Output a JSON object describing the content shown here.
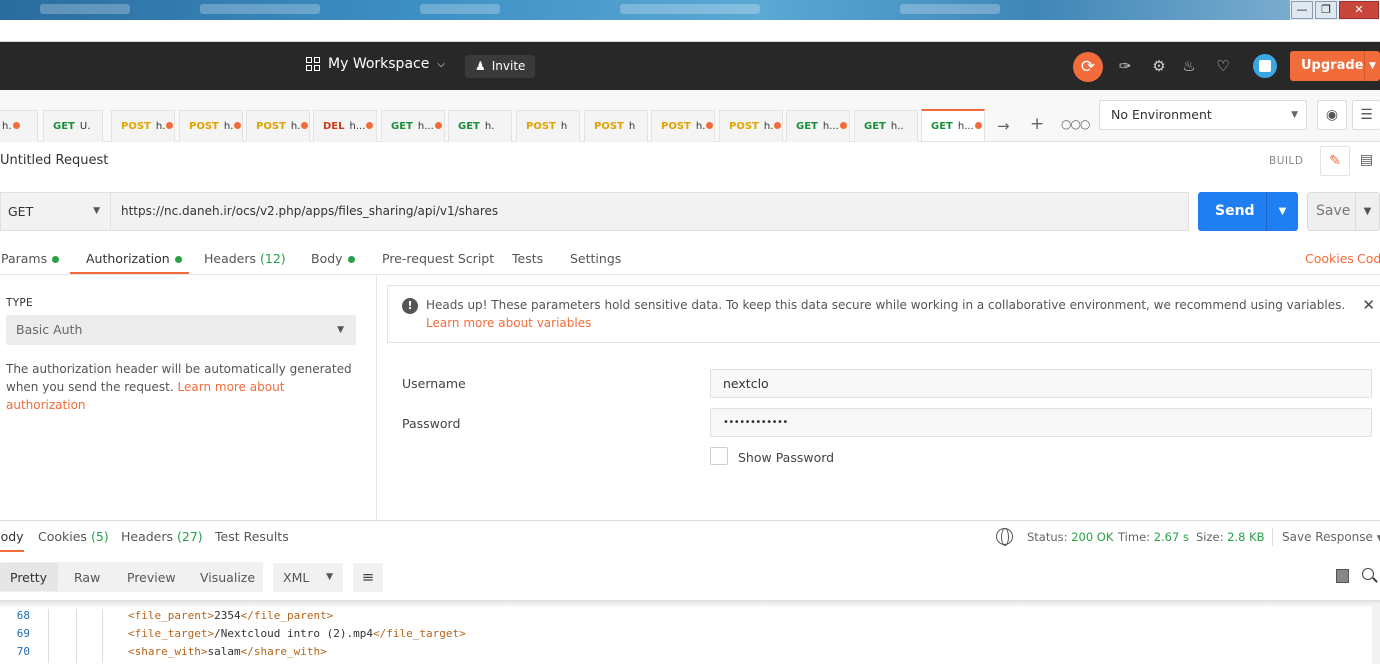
{
  "header": {
    "workspace": "My Workspace",
    "invite": "Invite",
    "upgrade": "Upgrade"
  },
  "tabs": [
    {
      "method": "",
      "label": "h.",
      "dot": true
    },
    {
      "method": "GET",
      "label": "U.",
      "dot": false
    },
    {
      "method": "POST",
      "label": "h.",
      "dot": true
    },
    {
      "method": "POST",
      "label": "h.",
      "dot": true
    },
    {
      "method": "POST",
      "label": "h.",
      "dot": true
    },
    {
      "method": "DEL",
      "label": "h...",
      "dot": true
    },
    {
      "method": "GET",
      "label": "h...",
      "dot": true
    },
    {
      "method": "GET",
      "label": "h.",
      "dot": false
    },
    {
      "method": "POST",
      "label": "h",
      "dot": false
    },
    {
      "method": "POST",
      "label": "h",
      "dot": false
    },
    {
      "method": "POST",
      "label": "h.",
      "dot": true
    },
    {
      "method": "POST",
      "label": "h.",
      "dot": true
    },
    {
      "method": "GET",
      "label": "h...",
      "dot": true
    },
    {
      "method": "GET",
      "label": "h..",
      "dot": false
    },
    {
      "method": "GET",
      "label": "h...",
      "dot": true,
      "active": true
    }
  ],
  "environment": {
    "selected": "No Environment"
  },
  "request": {
    "title": "Untitled Request",
    "build": "BUILD",
    "method": "GET",
    "url": "https://nc.daneh.ir/ocs/v2.php/apps/files_sharing/api/v1/shares",
    "send": "Send",
    "save": "Save"
  },
  "request_tabs": {
    "params": "Params",
    "authorization": "Authorization",
    "headers": "Headers",
    "headers_count": "(12)",
    "body": "Body",
    "prerequest": "Pre-request Script",
    "tests": "Tests",
    "settings": "Settings",
    "cookies": "Cookies",
    "code": "Cod"
  },
  "auth": {
    "type_label": "TYPE",
    "type_value": "Basic Auth",
    "description": "The authorization header will be automatically generated when you send the request.",
    "learn_more": "Learn more about authorization",
    "alert_text": "Heads up! These parameters hold sensitive data. To keep this data secure while working in a collaborative environment, we recommend using variables.",
    "alert_link": "Learn more about variables",
    "username_label": "Username",
    "username_value": "nextclo",
    "password_label": "Password",
    "password_value": "••••••••••••",
    "show_password": "Show Password"
  },
  "response": {
    "tabs": {
      "body": "Body",
      "cookies": "Cookies",
      "cookies_count": "(5)",
      "headers": "Headers",
      "headers_count": "(27)",
      "tests": "Test Results"
    },
    "status_label": "Status:",
    "status_value": "200 OK",
    "time_label": "Time:",
    "time_value": "2.67 s",
    "size_label": "Size:",
    "size_value": "2.8 KB",
    "save_response": "Save Response",
    "formats": {
      "pretty": "Pretty",
      "raw": "Raw",
      "preview": "Preview",
      "visualize": "Visualize",
      "lang": "XML"
    },
    "code_lines": [
      {
        "num": "68",
        "open": "<file_parent>",
        "text": "2354",
        "close": "</file_parent>"
      },
      {
        "num": "69",
        "open": "<file_target>",
        "text": "/Nextcloud intro (2).mp4",
        "close": "</file_target>"
      },
      {
        "num": "70",
        "open": "<share_with>",
        "text": "salam",
        "close": "</share_with>"
      }
    ]
  },
  "colors": {
    "accent": "#f26b3a",
    "send": "#1f7ef2",
    "ok": "#26a146"
  }
}
